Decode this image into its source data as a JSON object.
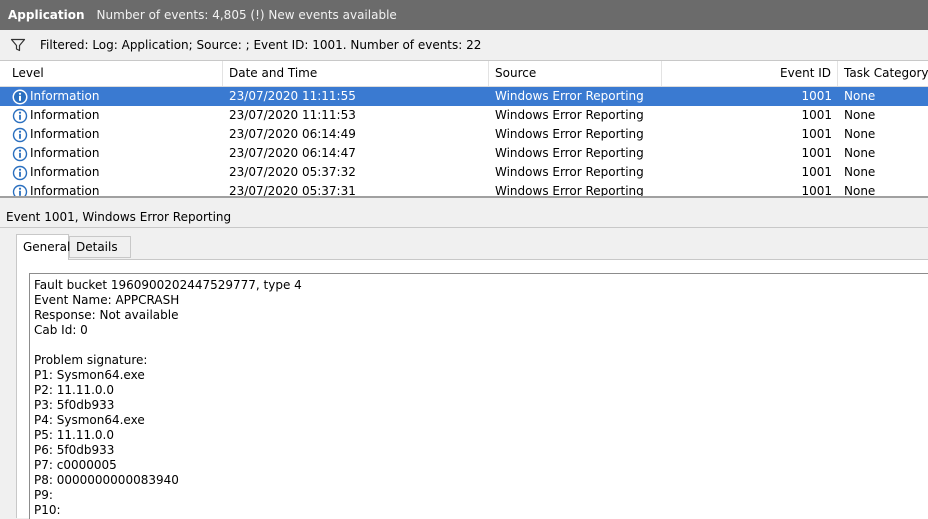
{
  "titlebar": {
    "app": "Application",
    "status": "Number of events: 4,805 (!) New events available"
  },
  "filter": {
    "icon": "filter-icon",
    "text": "Filtered: Log: Application; Source: ; Event ID: 1001. Number of events: 22"
  },
  "columns": {
    "level": "Level",
    "date": "Date and Time",
    "source": "Source",
    "event_id": "Event ID",
    "task": "Task Category"
  },
  "rows": [
    {
      "level": "Information",
      "date": "23/07/2020 11:11:55",
      "source": "Windows Error Reporting",
      "event_id": "1001",
      "task": "None"
    },
    {
      "level": "Information",
      "date": "23/07/2020 11:11:53",
      "source": "Windows Error Reporting",
      "event_id": "1001",
      "task": "None"
    },
    {
      "level": "Information",
      "date": "23/07/2020 06:14:49",
      "source": "Windows Error Reporting",
      "event_id": "1001",
      "task": "None"
    },
    {
      "level": "Information",
      "date": "23/07/2020 06:14:47",
      "source": "Windows Error Reporting",
      "event_id": "1001",
      "task": "None"
    },
    {
      "level": "Information",
      "date": "23/07/2020 05:37:32",
      "source": "Windows Error Reporting",
      "event_id": "1001",
      "task": "None"
    },
    {
      "level": "Information",
      "date": "23/07/2020 05:37:31",
      "source": "Windows Error Reporting",
      "event_id": "1001",
      "task": "None"
    }
  ],
  "detail": {
    "title": "Event 1001, Windows Error Reporting",
    "tabs": {
      "general": "General",
      "details": "Details"
    },
    "lines": [
      "Fault bucket 1960900202447529777, type 4",
      "Event Name: APPCRASH",
      "Response: Not available",
      "Cab Id: 0",
      "",
      "Problem signature:",
      "P1: Sysmon64.exe",
      "P2: 11.11.0.0",
      "P3: 5f0db933",
      "P4: Sysmon64.exe",
      "P5: 11.11.0.0",
      "P6: 5f0db933",
      "P7: c0000005",
      "P8: 0000000000083940",
      "P9:",
      "P10:"
    ]
  },
  "colors": {
    "titlebar": "#6b6b6b",
    "selected_row": "#3a7ad1",
    "info_icon": "#2a6fbf"
  }
}
